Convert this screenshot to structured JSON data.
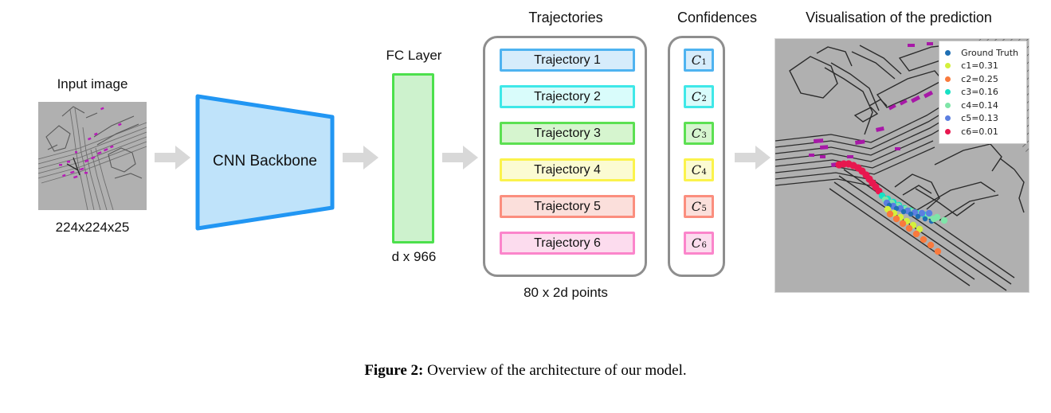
{
  "figure": {
    "caption_label": "Figure 2:",
    "caption_text": " Overview of the architecture of our model."
  },
  "input": {
    "title": "Input image",
    "dims": "224x224x25"
  },
  "cnn": {
    "label": "CNN Backbone",
    "fill": "#bfe3fa",
    "stroke": "#2196f3"
  },
  "fc": {
    "title": "FC Layer",
    "dims": "d x 966",
    "fill": "#cdf2cd",
    "stroke": "#4ce04c"
  },
  "trajectories": {
    "title": "Trajectories",
    "footer": "80 x 2d points",
    "items": [
      {
        "label": "Trajectory 1",
        "fill": "#d6ecfb",
        "stroke": "#4fb3f0"
      },
      {
        "label": "Trajectory 2",
        "fill": "#d9fcfb",
        "stroke": "#3fe8e8"
      },
      {
        "label": "Trajectory 3",
        "fill": "#d6f5cf",
        "stroke": "#5ce052"
      },
      {
        "label": "Trajectory 4",
        "fill": "#fbfbd2",
        "stroke": "#fbf34c"
      },
      {
        "label": "Trajectory 5",
        "fill": "#fbdfdb",
        "stroke": "#fb8e7e"
      },
      {
        "label": "Trajectory 6",
        "fill": "#fcdcee",
        "stroke": "#fb85cb"
      }
    ]
  },
  "confidences": {
    "title": "Confidences",
    "items": [
      {
        "symbol": "C",
        "sub": "1",
        "fill": "#d6ecfb",
        "stroke": "#4fb3f0"
      },
      {
        "symbol": "C",
        "sub": "2",
        "fill": "#d9fcfb",
        "stroke": "#3fe8e8"
      },
      {
        "symbol": "C",
        "sub": "3",
        "fill": "#d6f5cf",
        "stroke": "#5ce052"
      },
      {
        "symbol": "C",
        "sub": "4",
        "fill": "#fbfbd2",
        "stroke": "#fbf34c"
      },
      {
        "symbol": "C",
        "sub": "5",
        "fill": "#fbdfdb",
        "stroke": "#fb8e7e"
      },
      {
        "symbol": "C",
        "sub": "6",
        "fill": "#fcdcee",
        "stroke": "#fb85cb"
      }
    ]
  },
  "visualisation": {
    "title": "Visualisation of the prediction",
    "background": "#b0b0b0",
    "legend": [
      {
        "label": "Ground Truth",
        "color": "#1f6fb4"
      },
      {
        "label": "c1=0.31",
        "color": "#d4f03c"
      },
      {
        "label": "c2=0.25",
        "color": "#f97a3d"
      },
      {
        "label": "c3=0.16",
        "color": "#17e0c4"
      },
      {
        "label": "c4=0.14",
        "color": "#7fe5a8"
      },
      {
        "label": "c5=0.13",
        "color": "#5c7fe0"
      },
      {
        "label": "c6=0.01",
        "color": "#e8174f"
      }
    ]
  },
  "arrows": {
    "color": "#d8d8d8",
    "items": [
      "input-to-cnn",
      "cnn-to-fc",
      "fc-to-trajectories",
      "confidences-to-visualisation"
    ]
  }
}
